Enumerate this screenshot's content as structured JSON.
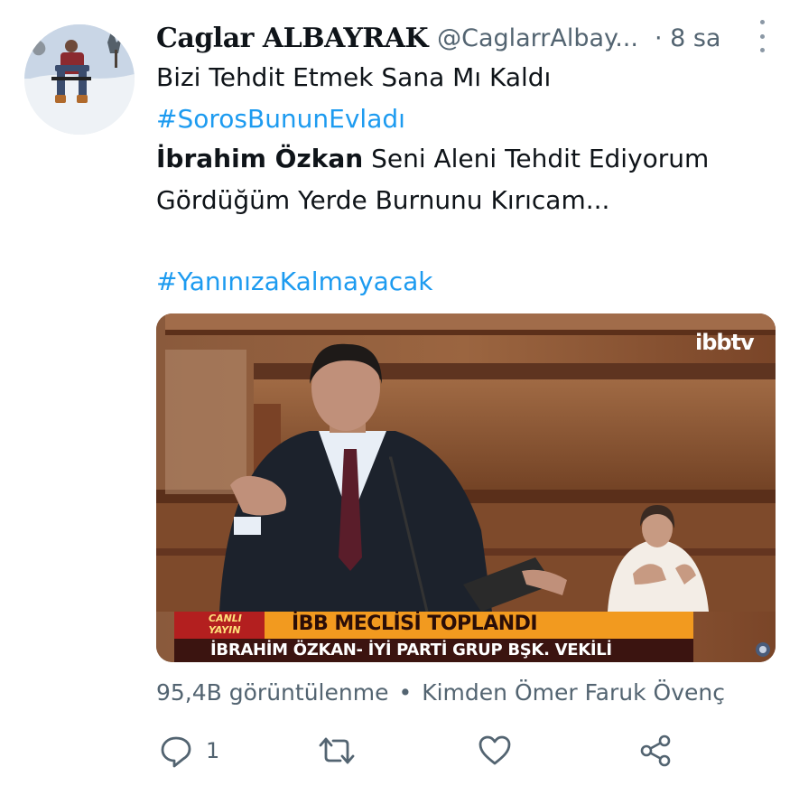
{
  "tweet": {
    "display_name": "Caglar ALBAYRAK",
    "handle": "@CaglarrAlbay...",
    "time": "· 8 sa",
    "lines": [
      "Bizi Tehdit Etmek Sana Mı Kaldı",
      "#SorosBununEvladı"
    ],
    "quote_name": "İbrahim Özkan",
    "quote_rest": " Seni Aleni Tehdit Ediyorum",
    "line4": "Gördüğüm Yerde Burnunu Kırıcam...",
    "hashtag2": "#YanınızaKalmayacak"
  },
  "media": {
    "logo": "ibbtv",
    "live_badge": "CANLI YAYIN",
    "headline": "İBB MECLİSİ TOPLANDI",
    "subline": "İBRAHİM ÖZKAN- İYİ PARTİ GRUP BŞK. VEKİLİ"
  },
  "meta": {
    "views": "95,4B görüntülenme",
    "separator": "•",
    "source": "Kimden Ömer Faruk Övenç"
  },
  "actions": {
    "reply_count": "1",
    "icons": [
      "reply-icon",
      "retweet-icon",
      "like-icon",
      "share-icon"
    ]
  },
  "colors": {
    "link": "#1d9bf0",
    "secondary_text": "#536471",
    "primary_text": "#0f1419",
    "banner_orange": "#f29a1f",
    "banner_dark": "#3b1410"
  }
}
